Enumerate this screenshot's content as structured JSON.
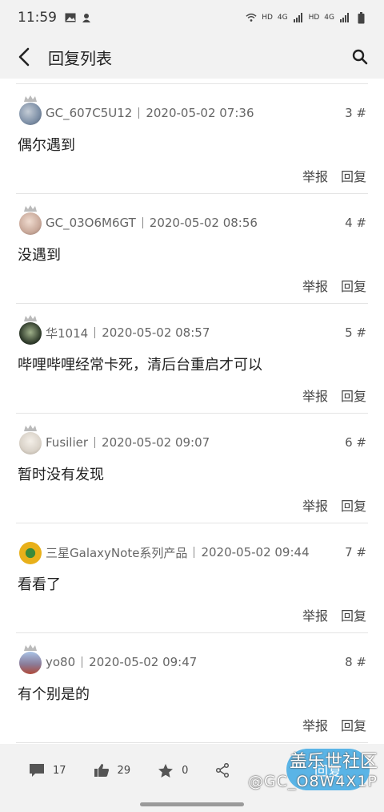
{
  "status_bar": {
    "time": "11:59",
    "network_labels": [
      "HD",
      "4G",
      "HD",
      "4G"
    ]
  },
  "header": {
    "title": "回复列表"
  },
  "replies": [
    {
      "user": "GC_607C5U12",
      "time": "2020-05-02 07:36",
      "floor": "3 #",
      "content": "偶尔遇到",
      "report": "举报",
      "reply": "回复",
      "avatar_color": "#7d8fa6"
    },
    {
      "user": "GC_03O6M6GT",
      "time": "2020-05-02 08:56",
      "floor": "4 #",
      "content": "没遇到",
      "report": "举报",
      "reply": "回复",
      "avatar_color": "#c9a99a"
    },
    {
      "user": "华1014",
      "time": "2020-05-02 08:57",
      "floor": "5 #",
      "content": "哔哩哔哩经常卡死，清后台重启才可以",
      "report": "举报",
      "reply": "回复",
      "avatar_color": "#2e3a2a"
    },
    {
      "user": "Fusilier",
      "time": "2020-05-02 09:07",
      "floor": "6 #",
      "content": "暂时没有发现",
      "report": "举报",
      "reply": "回复",
      "avatar_color": "#d9d2c8"
    },
    {
      "user": "三星GalaxyNote系列产品",
      "time": "2020-05-02 09:44",
      "floor": "7 #",
      "content": "看看了",
      "report": "举报",
      "reply": "回复",
      "avatar_color": "#e8b01a"
    },
    {
      "user": "yo80",
      "time": "2020-05-02 09:47",
      "floor": "8 #",
      "content": "有个别是的",
      "report": "举报",
      "reply": "回复",
      "avatar_color": "#8a7d9a"
    }
  ],
  "bottom_bar": {
    "comments": "17",
    "likes": "29",
    "favorites": "0",
    "reply_button": "回复"
  },
  "watermark": {
    "line1": "盖乐世社区",
    "line2": "@GC_O8W4X1P"
  }
}
